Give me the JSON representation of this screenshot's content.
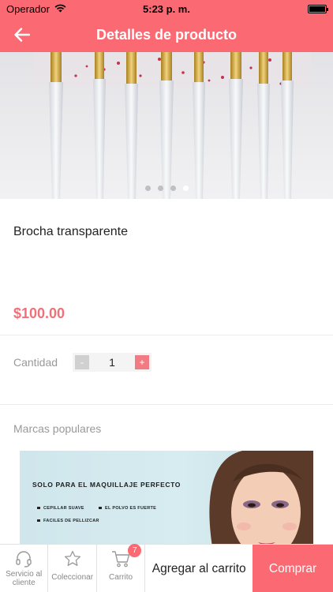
{
  "status_bar": {
    "carrier": "Operador",
    "time": "5:23 p. m.",
    "battery_level": 1.0
  },
  "nav": {
    "title": "Detalles de producto"
  },
  "hero": {
    "image_count": 4,
    "active_index": 3
  },
  "product": {
    "name": "Brocha transparente",
    "price": "$100.00"
  },
  "quantity": {
    "label": "Cantidad",
    "minus": "-",
    "value": "1",
    "plus": "+"
  },
  "brands": {
    "label": "Marcas populares",
    "banner": {
      "headline": "SOLO PARA EL MAQUILLAJE PERFECTO",
      "line1": "CEPILLAR SUAVE",
      "line2": "EL POLVO ES FUERTE",
      "line3": "FACILES DE PELLIZCAR"
    }
  },
  "bottom_bar": {
    "service_label": "Servicio al cliente",
    "collect_label": "Coleccionar",
    "cart_label": "Carrito",
    "cart_badge": "7",
    "add_to_cart": "Agregar al carrito",
    "buy": "Comprar"
  },
  "colors": {
    "accent": "#fb6a73",
    "price": "#f07079"
  }
}
